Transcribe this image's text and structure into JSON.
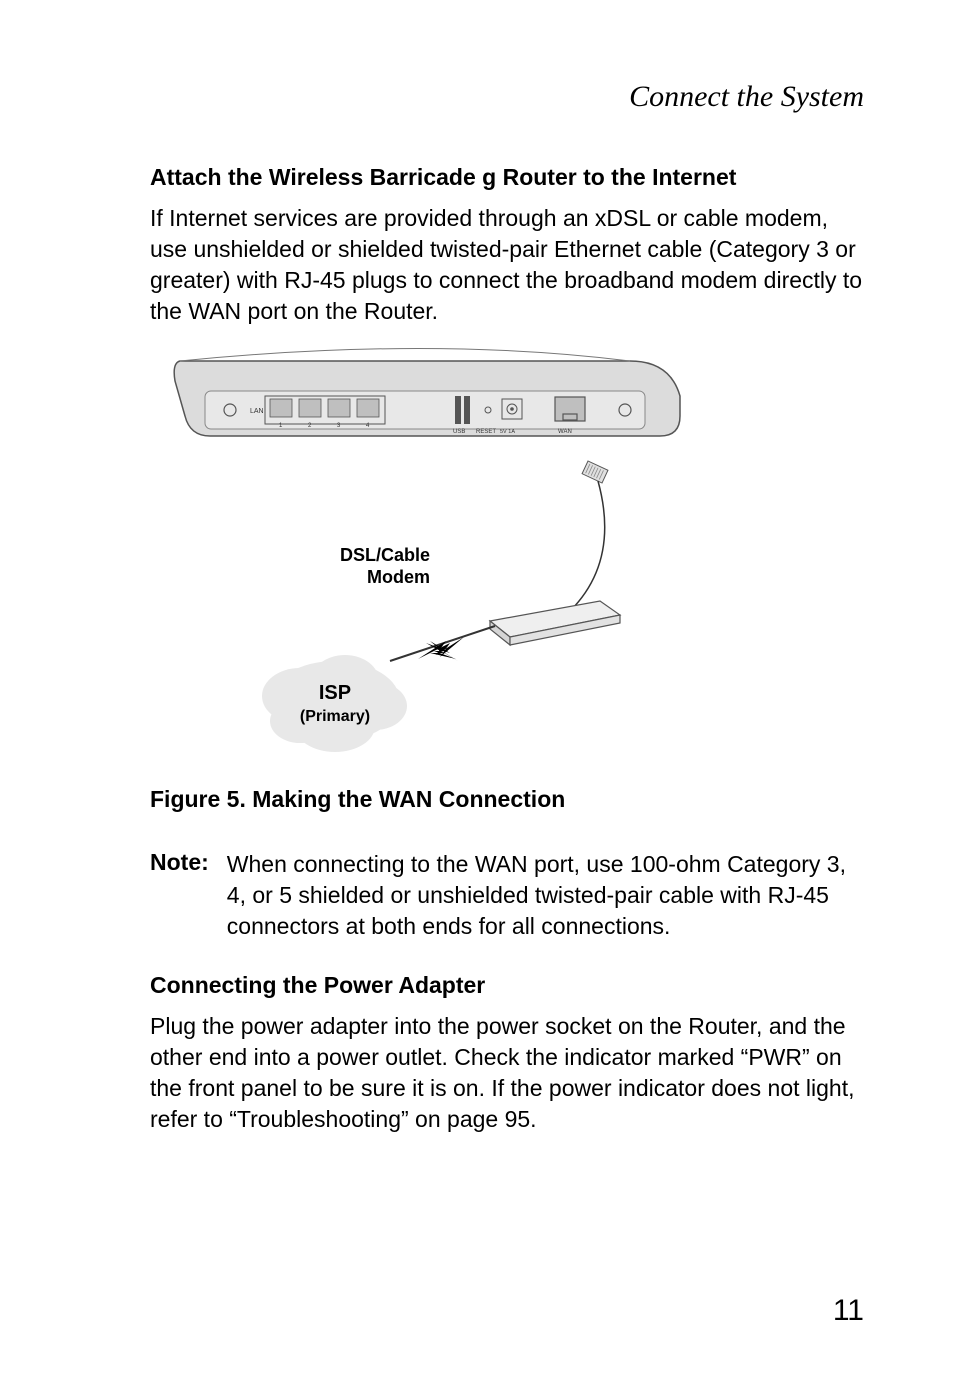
{
  "header": {
    "running_title": "Connect the System"
  },
  "section1": {
    "heading": "Attach the Wireless Barricade g Router to the Internet",
    "body": "If Internet services are provided through an xDSL or cable modem, use unshielded or shielded twisted-pair Ethernet cable (Category 3 or greater) with RJ-45 plugs to connect the broadband modem directly to the WAN port on the Router."
  },
  "figure": {
    "label_dsl": "DSL/Cable",
    "label_modem": "Modem",
    "label_isp": "ISP",
    "label_primary": "(Primary)",
    "router_labels": {
      "lan": "LAN",
      "port1": "1",
      "port2": "2",
      "port3": "3",
      "port4": "4",
      "usb": "USB",
      "reset": "RESET",
      "volt": "5V 1A",
      "wan": "WAN"
    },
    "caption": "Figure 5.  Making the WAN Connection"
  },
  "note": {
    "label": "Note:",
    "body": "When connecting to the WAN port, use 100-ohm Category 3, 4, or 5 shielded or unshielded twisted-pair cable with RJ-45 connectors at both ends for all connections."
  },
  "section2": {
    "heading": "Connecting the Power Adapter",
    "body": "Plug the power adapter into the power socket on the Router, and the other end into a power outlet. Check the indicator marked “PWR” on the front panel to be sure it is on. If the power indicator does not light, refer to “Troubleshooting” on page 95."
  },
  "page_number": "11"
}
